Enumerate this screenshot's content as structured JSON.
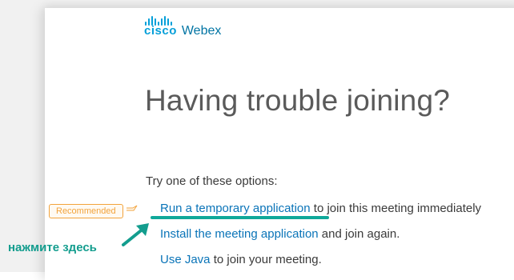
{
  "brand": {
    "cisco": "cisco",
    "webex": "Webex",
    "color": "#049fd9",
    "webex_color": "#0074a3"
  },
  "headline": "Having trouble joining?",
  "options_intro": "Try one of these options:",
  "options": [
    {
      "link": "Run a temporary application",
      "rest": " to join this meeting immediately"
    },
    {
      "link": "Install the meeting application",
      "rest": " and join again."
    },
    {
      "link": "Use Java",
      "rest": " to join your meeting."
    }
  ],
  "recommended_badge": "Recommended",
  "annotation": {
    "text": "нажмите здесь",
    "color": "#139d8e",
    "icon": "arrow-up-right-icon"
  },
  "colors": {
    "link": "#0a74b8",
    "badge": "#f2a33c",
    "text": "#3a3a3a",
    "headline": "#5a5a5a"
  }
}
